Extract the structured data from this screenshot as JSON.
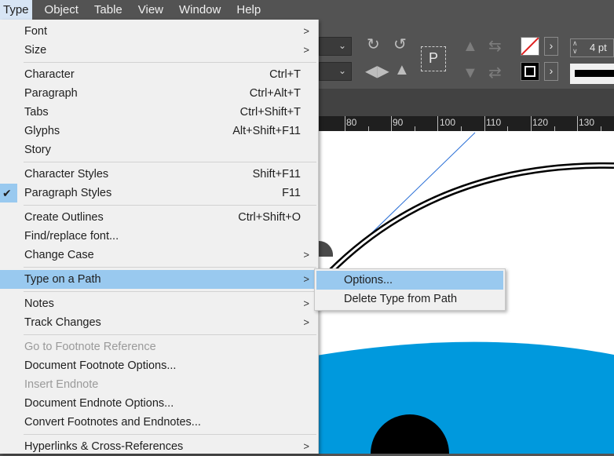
{
  "menubar": {
    "items": [
      {
        "label": "Type",
        "active": true
      },
      {
        "label": "Object"
      },
      {
        "label": "Table"
      },
      {
        "label": "View"
      },
      {
        "label": "Window"
      },
      {
        "label": "Help"
      }
    ]
  },
  "control_panel": {
    "stroke_weight": "4 pt"
  },
  "ruler": {
    "labels": [
      "80",
      "90",
      "100",
      "110",
      "120",
      "130"
    ]
  },
  "type_menu": {
    "font": "Font",
    "size": "Size",
    "character": "Character",
    "character_sc": "Ctrl+T",
    "paragraph": "Paragraph",
    "paragraph_sc": "Ctrl+Alt+T",
    "tabs": "Tabs",
    "tabs_sc": "Ctrl+Shift+T",
    "glyphs": "Glyphs",
    "glyphs_sc": "Alt+Shift+F11",
    "story": "Story",
    "character_styles": "Character Styles",
    "character_styles_sc": "Shift+F11",
    "paragraph_styles": "Paragraph Styles",
    "paragraph_styles_sc": "F11",
    "create_outlines": "Create Outlines",
    "create_outlines_sc": "Ctrl+Shift+O",
    "find_replace_font": "Find/replace font...",
    "change_case": "Change Case",
    "type_on_path": "Type on a Path",
    "notes": "Notes",
    "track_changes": "Track Changes",
    "go_to_footnote": "Go to Footnote Reference",
    "doc_footnote_options": "Document Footnote Options...",
    "insert_endnote": "Insert Endnote",
    "doc_endnote_options": "Document Endnote Options...",
    "convert_footnotes": "Convert Footnotes and Endnotes...",
    "hyperlinks": "Hyperlinks & Cross-References"
  },
  "type_on_path_submenu": {
    "options": "Options...",
    "delete_type": "Delete Type from Path"
  },
  "colors": {
    "menu_bg": "#f0f0f0",
    "highlight": "#99c9ef",
    "app_chrome": "#535353",
    "shape_blue": "#0099dd"
  }
}
